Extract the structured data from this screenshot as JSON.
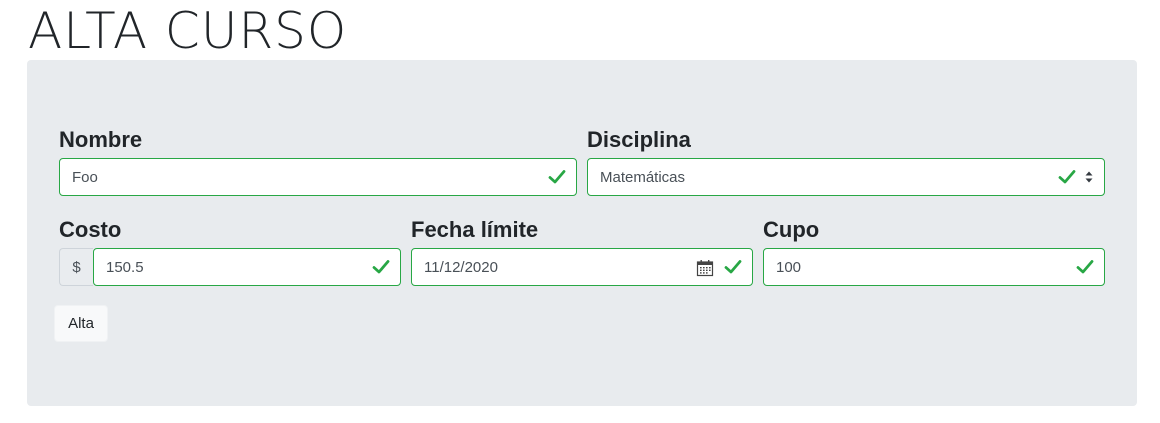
{
  "page": {
    "title": "ALTA CURSO"
  },
  "form": {
    "nombre": {
      "label": "Nombre",
      "value": "Foo"
    },
    "disciplina": {
      "label": "Disciplina",
      "value": "Matemáticas"
    },
    "costo": {
      "label": "Costo",
      "prefix": "$",
      "value": "150.5"
    },
    "fecha": {
      "label": "Fecha límite",
      "value": "11/12/2020"
    },
    "cupo": {
      "label": "Cupo",
      "value": "100"
    },
    "submit_label": "Alta"
  },
  "colors": {
    "valid": "#28a745",
    "panel_bg": "#e8ebee"
  },
  "icons": {
    "valid": "check-icon",
    "date": "calendar-icon",
    "select": "select-arrows-icon"
  }
}
